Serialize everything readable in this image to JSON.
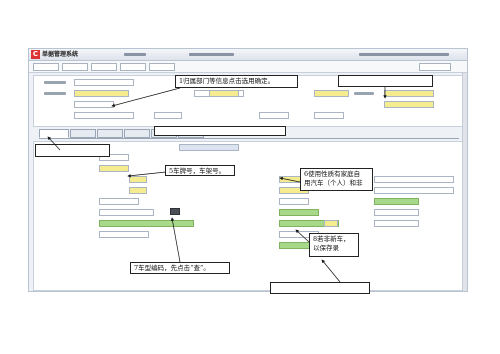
{
  "window": {
    "logo": "C",
    "title": "单据管理系统"
  },
  "callouts": {
    "c1": "1归属部门等信息点击选用确定。",
    "c5": "5车牌号，车架号。",
    "c6_line1": "6使用性质有家庭自",
    "c6_line2": "用汽车（个人）和非",
    "c7": "7车型编码，先点击“查”。",
    "c8_line1": "8若非新车，",
    "c8_line2": "以保存录"
  },
  "colors": {
    "accent_green": "#a8d98a",
    "highlight_yellow": "#f4ec8f",
    "window_bg": "#eef1f5"
  }
}
